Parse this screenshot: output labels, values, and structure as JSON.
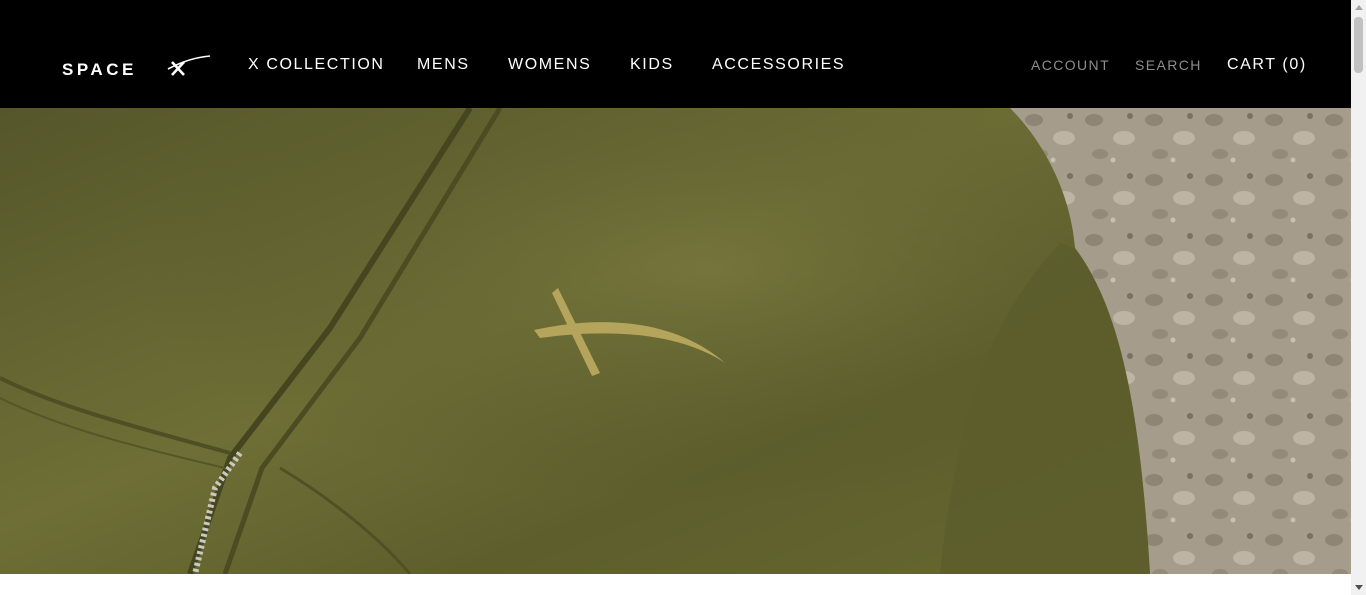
{
  "brand": {
    "logo_text": "SPACEX",
    "logo_icon": "spacex-wordmark"
  },
  "nav": {
    "items": [
      {
        "label": "X COLLECTION"
      },
      {
        "label": "MENS"
      },
      {
        "label": "WOMENS"
      },
      {
        "label": "KIDS"
      },
      {
        "label": "ACCESSORIES"
      }
    ]
  },
  "utility": {
    "account": "ACCOUNT",
    "search": "SEARCH",
    "cart": "CART (0)"
  },
  "hero": {
    "image": "olive-green-zip-hoodie-with-x-logo-on-rocky-ground",
    "colors": {
      "fabric": "#6a6a32",
      "logo": "#b5a45c",
      "ground": "#a89e8e"
    }
  },
  "colors": {
    "header_bg": "#000000",
    "nav_text": "#ffffff",
    "util_text": "#8c8c8c"
  }
}
